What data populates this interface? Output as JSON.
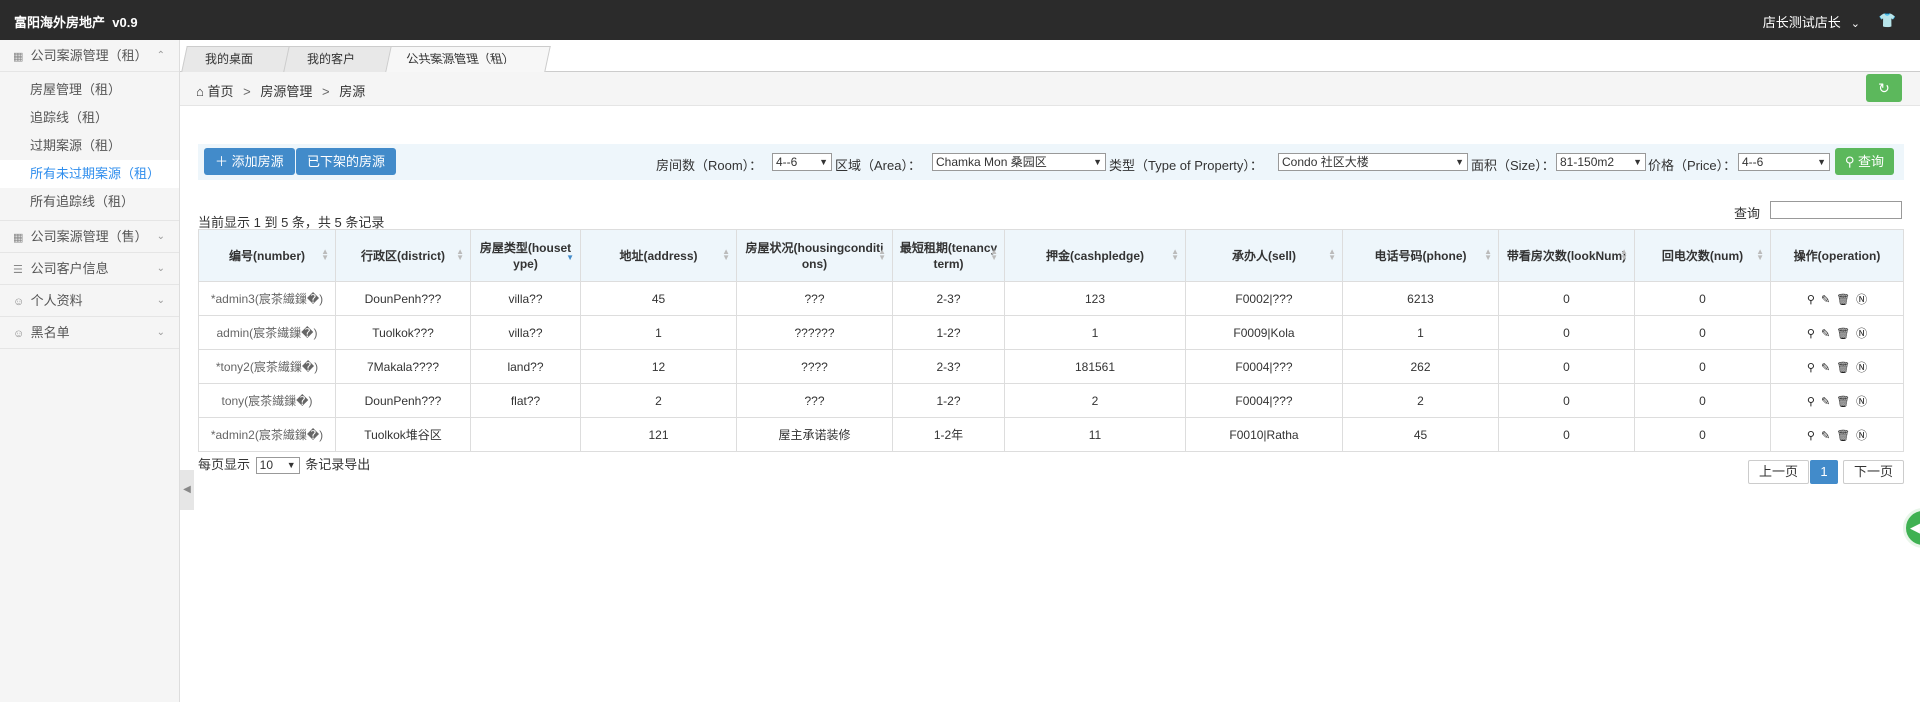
{
  "app": {
    "title": "富阳海外房地产",
    "version": "v0.9",
    "user": "店长测试店长"
  },
  "sidebar": {
    "groups": [
      {
        "label": "公司案源管理（租）",
        "icon": "building-icon",
        "expanded": true,
        "items": [
          "房屋管理（租）",
          "追踪线（租）",
          "过期案源（租）",
          "所有未过期案源（租）",
          "所有追踪线（租）"
        ],
        "active": 3
      },
      {
        "label": "公司案源管理（售）",
        "icon": "building-icon"
      },
      {
        "label": "公司客户信息",
        "icon": "list-icon"
      },
      {
        "label": "个人资料",
        "icon": "user-icon"
      },
      {
        "label": "黑名单",
        "icon": "user-icon"
      }
    ]
  },
  "tabs": [
    {
      "label": "我的桌面"
    },
    {
      "label": "我的客户"
    },
    {
      "label": "公共案源管理（租）",
      "close": "×"
    }
  ],
  "breadcrumb": {
    "home": "首页",
    "sep": ">",
    "level1": "房源管理",
    "level2": "房源"
  },
  "toolbar": {
    "add_label": "添加房源",
    "offline_label": "已下架的房源",
    "room_label": "房间数（Room）：",
    "room_value": "4--6",
    "area_label": "区域（Area）：",
    "area_value": "Chamka Mon 桑园区",
    "type_label": "类型（Type of Property）：",
    "type_value": "Condo 社区大楼",
    "size_label": "面积（Size）：",
    "size_value": "81-150m2",
    "price_label": "价格（Price）：",
    "price_value": "4--6",
    "query_label": "查询"
  },
  "list": {
    "info": "当前显示 1 到 5 条，共 5 条记录",
    "search_label": "查询",
    "headers": [
      "编号(number)",
      "行政区(district)",
      "房屋类型(housetype)",
      "地址(address)",
      "房屋状况(housingconditions)",
      "最短租期(tenancyterm)",
      "押金(cashpledge)",
      "承办人(sell)",
      "电话号码(phone)",
      "带看房次数(lookNum)",
      "回电次数(num)",
      "操作(operation)"
    ],
    "rows": [
      [
        "*admin3(宸茶繊鏁�)",
        "DounPenh???",
        "villa??",
        "45",
        "???",
        "2-3?",
        "123",
        "F0002|???",
        "6213",
        "0",
        "0"
      ],
      [
        "admin(宸茶繊鏁�)",
        "Tuolkok???",
        "villa??",
        "1",
        "??????",
        "1-2?",
        "1",
        "F0009|Kola",
        "1",
        "0",
        "0"
      ],
      [
        "*tony2(宸茶繊鏁�)",
        "7Makala????",
        "land??",
        "12",
        "????",
        "2-3?",
        "181561",
        "F0004|???",
        "262",
        "0",
        "0"
      ],
      [
        "tony(宸茶繊鏁�)",
        "DounPenh???",
        "flat??",
        "2",
        "???",
        "1-2?",
        "2",
        "F0004|???",
        "2",
        "0",
        "0"
      ],
      [
        "*admin2(宸茶繊鏁�)",
        "Tuolkok堆谷区",
        "",
        "121",
        "屋主承诺装修",
        "1-2年",
        "11",
        "F0010|Ratha",
        "45",
        "0",
        "0"
      ]
    ]
  },
  "footer": {
    "per_page_prefix": "每页显示",
    "per_page_value": "10",
    "per_page_suffix": "条记录导出",
    "prev": "上一页",
    "current": "1",
    "next": "下一页"
  }
}
